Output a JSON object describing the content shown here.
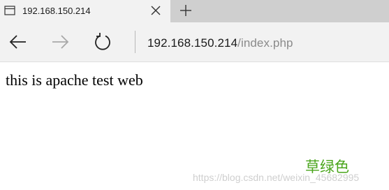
{
  "tab": {
    "title": "192.168.150.214",
    "page_icon": "page-icon",
    "close_icon": "close-icon"
  },
  "new_tab_icon": "plus-icon",
  "toolbar": {
    "back_icon": "back-arrow-icon",
    "forward_icon": "forward-arrow-icon",
    "refresh_icon": "refresh-icon",
    "address_host": "192.168.150.214",
    "address_path": "/index.php"
  },
  "page": {
    "text": "this is apache test web"
  },
  "watermark": {
    "label": "草绿色",
    "url": "https://blog.csdn.net/weixin_45682995"
  },
  "colors": {
    "tabstrip": "#cfcfcf",
    "toolbar": "#f2f2f2",
    "watermark_green": "#4aa51c"
  }
}
